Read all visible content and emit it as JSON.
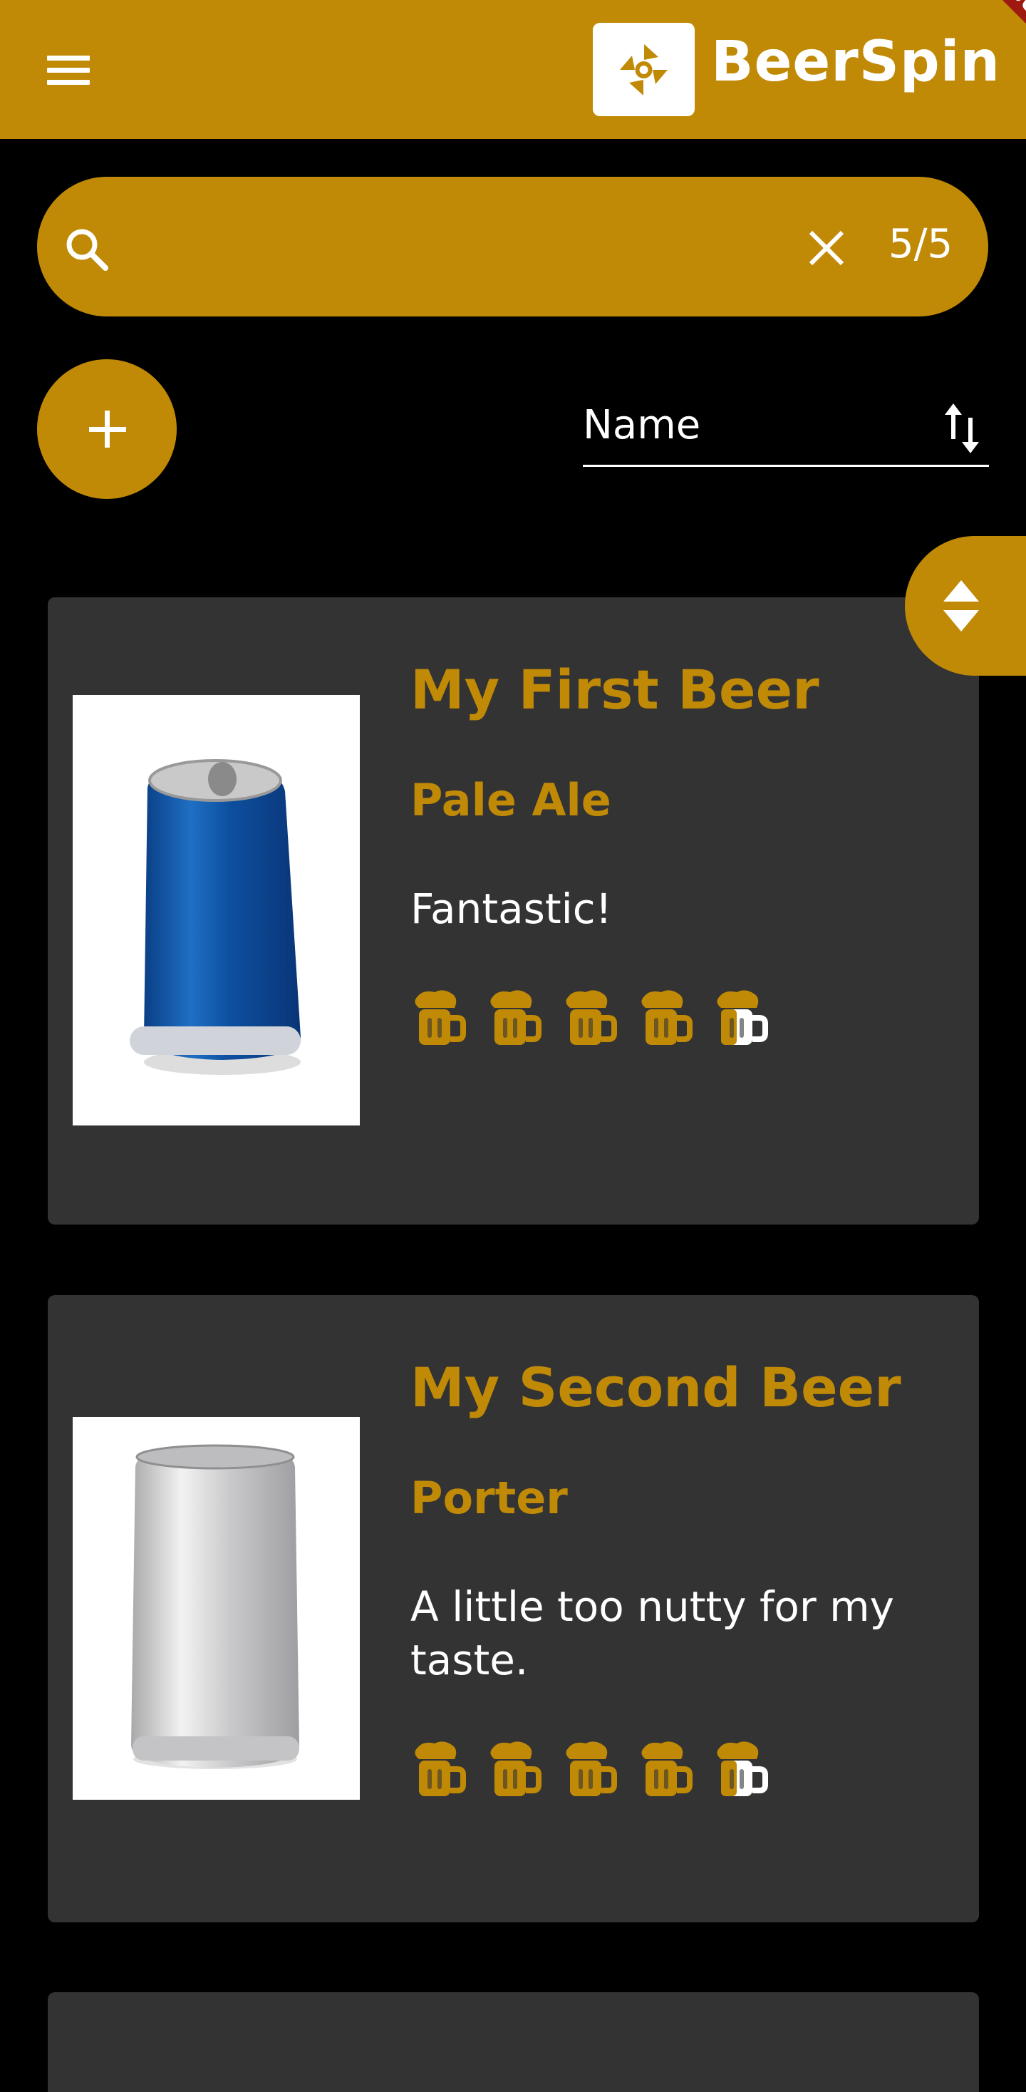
{
  "app": {
    "title": "BeerSpin",
    "debug_banner": "DEBUG",
    "accent_color": "#c08a06",
    "card_color": "#333333"
  },
  "search": {
    "value": "",
    "placeholder": "",
    "count": "5/5"
  },
  "sort": {
    "selected": "Name"
  },
  "beers": [
    {
      "name": "My First Beer",
      "style": "Pale Ale",
      "comment": "Fantastic!",
      "rating": 4.5,
      "rating_max": 5,
      "image": "blue-can"
    },
    {
      "name": "My Second Beer",
      "style": "Porter",
      "comment": "A little too nutty for my taste.",
      "rating": 4.5,
      "rating_max": 5,
      "image": "silver-can"
    }
  ],
  "icons": {
    "menu": "menu-icon",
    "logo": "beerspin-logo-icon",
    "search": "search-icon",
    "clear": "close-icon",
    "add": "plus-icon",
    "sort": "sort-arrows-icon",
    "scroll": "up-down-triangle-icon",
    "rating": "beer-mug-icon"
  }
}
